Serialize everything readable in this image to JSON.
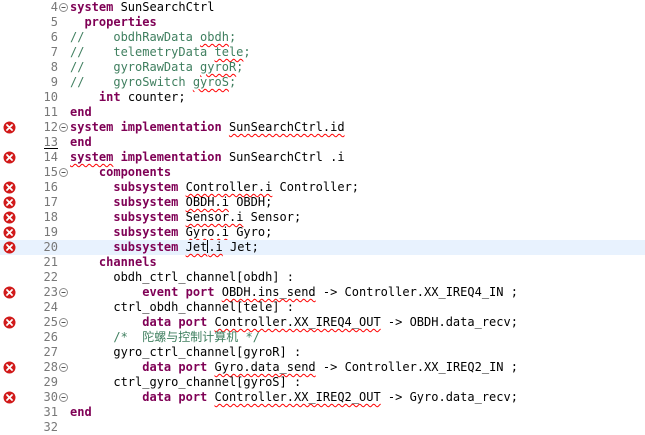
{
  "editor": {
    "lines": [
      {
        "n": "4",
        "fold": "minus",
        "err": false,
        "segments": [
          {
            "t": "system",
            "c": "kw"
          },
          {
            "t": " SunSearchCtrl",
            "c": ""
          }
        ]
      },
      {
        "n": "5",
        "fold": "",
        "err": false,
        "segments": [
          {
            "t": "  ",
            "c": ""
          },
          {
            "t": "properties",
            "c": "kw"
          }
        ]
      },
      {
        "n": "6",
        "fold": "",
        "err": false,
        "segments": [
          {
            "t": "//    obdhRawData ",
            "c": "cm"
          },
          {
            "t": "obdh",
            "c": "cm sq"
          },
          {
            "t": ";",
            "c": "cm"
          }
        ]
      },
      {
        "n": "7",
        "fold": "",
        "err": false,
        "segments": [
          {
            "t": "//    telemetryData ",
            "c": "cm"
          },
          {
            "t": "tele",
            "c": "cm sq"
          },
          {
            "t": ";",
            "c": "cm"
          }
        ]
      },
      {
        "n": "8",
        "fold": "",
        "err": false,
        "segments": [
          {
            "t": "//    gyroRawData ",
            "c": "cm"
          },
          {
            "t": "gyroR",
            "c": "cm sq"
          },
          {
            "t": ";",
            "c": "cm"
          }
        ]
      },
      {
        "n": "9",
        "fold": "",
        "err": false,
        "segments": [
          {
            "t": "//    gyroSwitch ",
            "c": "cm"
          },
          {
            "t": "gyroS",
            "c": "cm sq"
          },
          {
            "t": ";",
            "c": "cm"
          }
        ]
      },
      {
        "n": "10",
        "fold": "",
        "err": false,
        "segments": [
          {
            "t": "    ",
            "c": ""
          },
          {
            "t": "int",
            "c": "kw"
          },
          {
            "t": " counter;",
            "c": ""
          }
        ]
      },
      {
        "n": "11",
        "fold": "",
        "err": false,
        "segments": [
          {
            "t": "end",
            "c": "kw"
          }
        ]
      },
      {
        "n": "12",
        "fold": "minus",
        "err": true,
        "segments": [
          {
            "t": "system implementation",
            "c": "kw"
          },
          {
            "t": " ",
            "c": ""
          },
          {
            "t": "SunSearchCtrl.id",
            "c": "sq"
          }
        ]
      },
      {
        "n": "13",
        "fold": "",
        "err": false,
        "segments": [
          {
            "t": "end",
            "c": "kw"
          }
        ]
      },
      {
        "n": "14",
        "fold": "",
        "err": true,
        "segments": [
          {
            "t": "system",
            "c": "kw sq"
          },
          {
            "t": " implementation",
            "c": "kw"
          },
          {
            "t": " SunSearchCtrl .i",
            "c": ""
          }
        ]
      },
      {
        "n": "15",
        "fold": "minus",
        "err": false,
        "segments": [
          {
            "t": "    ",
            "c": ""
          },
          {
            "t": "components",
            "c": "kw"
          }
        ]
      },
      {
        "n": "16",
        "fold": "",
        "err": true,
        "segments": [
          {
            "t": "      ",
            "c": ""
          },
          {
            "t": "subsystem",
            "c": "kw"
          },
          {
            "t": " ",
            "c": ""
          },
          {
            "t": "Controller.i",
            "c": "sq"
          },
          {
            "t": " Controller;",
            "c": ""
          }
        ]
      },
      {
        "n": "17",
        "fold": "",
        "err": true,
        "segments": [
          {
            "t": "      ",
            "c": ""
          },
          {
            "t": "subsystem",
            "c": "kw"
          },
          {
            "t": " ",
            "c": ""
          },
          {
            "t": "OBDH.i",
            "c": "sq"
          },
          {
            "t": " OBDH;",
            "c": ""
          }
        ]
      },
      {
        "n": "18",
        "fold": "",
        "err": true,
        "segments": [
          {
            "t": "      ",
            "c": ""
          },
          {
            "t": "subsystem",
            "c": "kw"
          },
          {
            "t": " ",
            "c": ""
          },
          {
            "t": "Sensor.i",
            "c": "sq"
          },
          {
            "t": " Sensor;",
            "c": ""
          }
        ]
      },
      {
        "n": "19",
        "fold": "",
        "err": true,
        "segments": [
          {
            "t": "      ",
            "c": ""
          },
          {
            "t": "subsystem",
            "c": "kw"
          },
          {
            "t": " ",
            "c": ""
          },
          {
            "t": "Gyro.i",
            "c": "sq"
          },
          {
            "t": " Gyro;",
            "c": ""
          }
        ]
      },
      {
        "n": "20",
        "fold": "",
        "err": true,
        "current": true,
        "segments": [
          {
            "t": "      ",
            "c": ""
          },
          {
            "t": "subsystem",
            "c": "kw"
          },
          {
            "t": " ",
            "c": ""
          },
          {
            "t": "Jet",
            "c": "sq"
          },
          {
            "t": "|",
            "c": "cursor"
          },
          {
            "t": ".i",
            "c": "sq"
          },
          {
            "t": " Jet;",
            "c": ""
          }
        ]
      },
      {
        "n": "21",
        "fold": "",
        "err": false,
        "segments": [
          {
            "t": "    ",
            "c": ""
          },
          {
            "t": "channels",
            "c": "kw"
          }
        ]
      },
      {
        "n": "22",
        "fold": "",
        "err": false,
        "segments": [
          {
            "t": "      obdh_ctrl_channel[obdh] :",
            "c": ""
          }
        ]
      },
      {
        "n": "23",
        "fold": "minus",
        "err": true,
        "segments": [
          {
            "t": "          ",
            "c": ""
          },
          {
            "t": "event port",
            "c": "kw"
          },
          {
            "t": " ",
            "c": ""
          },
          {
            "t": "OBDH.ins_send",
            "c": "sq"
          },
          {
            "t": " -> Controller.XX_IREQ4_IN ;",
            "c": ""
          }
        ]
      },
      {
        "n": "24",
        "fold": "",
        "err": false,
        "segments": [
          {
            "t": "      ctrl_obdh_channel[tele] :",
            "c": ""
          }
        ]
      },
      {
        "n": "25",
        "fold": "minus",
        "err": true,
        "segments": [
          {
            "t": "          ",
            "c": ""
          },
          {
            "t": "data port",
            "c": "kw"
          },
          {
            "t": " ",
            "c": ""
          },
          {
            "t": "Controller.XX_IREQ4_OUT",
            "c": "sq"
          },
          {
            "t": " -> OBDH.data_recv;",
            "c": ""
          }
        ]
      },
      {
        "n": "26",
        "fold": "",
        "err": false,
        "segments": [
          {
            "t": "      /*  陀螺与控制计算机 */",
            "c": "cm"
          }
        ]
      },
      {
        "n": "27",
        "fold": "",
        "err": false,
        "segments": [
          {
            "t": "      gyro_ctrl_channel[gyroR] :",
            "c": ""
          }
        ]
      },
      {
        "n": "28",
        "fold": "minus",
        "err": true,
        "segments": [
          {
            "t": "          ",
            "c": ""
          },
          {
            "t": "data port",
            "c": "kw"
          },
          {
            "t": " ",
            "c": ""
          },
          {
            "t": "Gyro.data_send",
            "c": "sq"
          },
          {
            "t": " -> Controller.XX_IREQ2_IN ;",
            "c": ""
          }
        ]
      },
      {
        "n": "29",
        "fold": "",
        "err": false,
        "segments": [
          {
            "t": "      ctrl_gyro_channel[gyroS] :",
            "c": ""
          }
        ]
      },
      {
        "n": "30",
        "fold": "minus",
        "err": true,
        "segments": [
          {
            "t": "          ",
            "c": ""
          },
          {
            "t": "data port",
            "c": "kw"
          },
          {
            "t": " ",
            "c": ""
          },
          {
            "t": "Controller.XX_IREQ2_OUT",
            "c": "sq"
          },
          {
            "t": " -> Gyro.data_recv;",
            "c": ""
          }
        ]
      },
      {
        "n": "31",
        "fold": "",
        "err": false,
        "segments": [
          {
            "t": "end",
            "c": "kw"
          }
        ]
      },
      {
        "n": "32",
        "fold": "",
        "err": false,
        "segments": []
      }
    ]
  },
  "colors": {
    "keyword": "#7f0055",
    "comment": "#3f7f5f",
    "error": "#d11a1a",
    "current_line": "#e8f2fe"
  },
  "icons": {
    "error": "error-x-icon",
    "fold": "fold-collapse-icon"
  }
}
